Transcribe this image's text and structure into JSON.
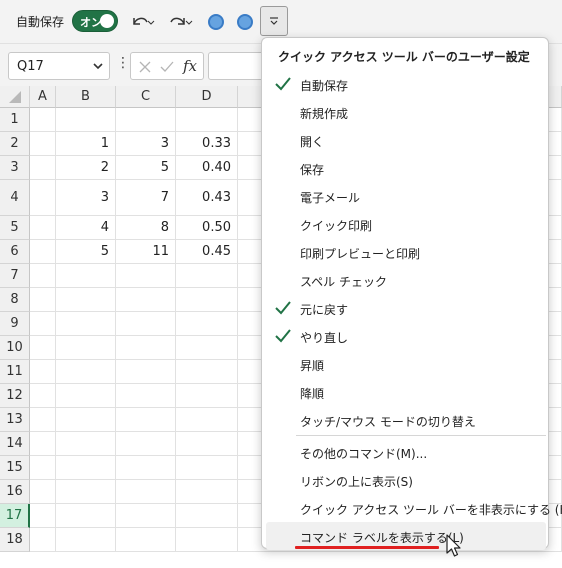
{
  "qat": {
    "autosave_label": "自動保存",
    "autosave_toggle": "オン",
    "accent": "#217346"
  },
  "formula_bar": {
    "name_box": "Q17",
    "fx_label": "fx",
    "formula": ""
  },
  "sheet": {
    "columns": [
      "A",
      "B",
      "C",
      "D"
    ],
    "rows": [
      "1",
      "2",
      "3",
      "4",
      "5",
      "6",
      "7",
      "8",
      "9",
      "10",
      "11",
      "12",
      "13",
      "14",
      "15",
      "16",
      "17",
      "18"
    ],
    "active_row": "17",
    "data": [
      {
        "row": "2",
        "B": "1",
        "C": "3",
        "D": "0.33"
      },
      {
        "row": "3",
        "B": "2",
        "C": "5",
        "D": "0.40"
      },
      {
        "row": "4",
        "B": "3",
        "C": "7",
        "D": "0.43"
      },
      {
        "row": "5",
        "B": "4",
        "C": "8",
        "D": "0.50"
      },
      {
        "row": "6",
        "B": "5",
        "C": "11",
        "D": "0.45"
      }
    ]
  },
  "menu": {
    "title": "クイック アクセス ツール バーのユーザー設定",
    "items": [
      {
        "label": "自動保存",
        "checked": true
      },
      {
        "label": "新規作成",
        "checked": false
      },
      {
        "label": "開く",
        "checked": false
      },
      {
        "label": "保存",
        "checked": false
      },
      {
        "label": "電子メール",
        "checked": false
      },
      {
        "label": "クイック印刷",
        "checked": false
      },
      {
        "label": "印刷プレビューと印刷",
        "checked": false
      },
      {
        "label": "スペル チェック",
        "checked": false
      },
      {
        "label": "元に戻す",
        "checked": true
      },
      {
        "label": "やり直し",
        "checked": true
      },
      {
        "label": "昇順",
        "checked": false
      },
      {
        "label": "降順",
        "checked": false
      },
      {
        "label": "タッチ/マウス モードの切り替え",
        "checked": false
      }
    ],
    "more_items": [
      {
        "label": "その他のコマンド(M)..."
      },
      {
        "label": "リボンの上に表示(S)"
      },
      {
        "label": "クイック アクセス ツール バーを非表示にする (H)"
      },
      {
        "label": "コマンド ラベルを表示する(L)"
      }
    ],
    "check_color": "#217346",
    "highlight_color": "#e02020"
  }
}
